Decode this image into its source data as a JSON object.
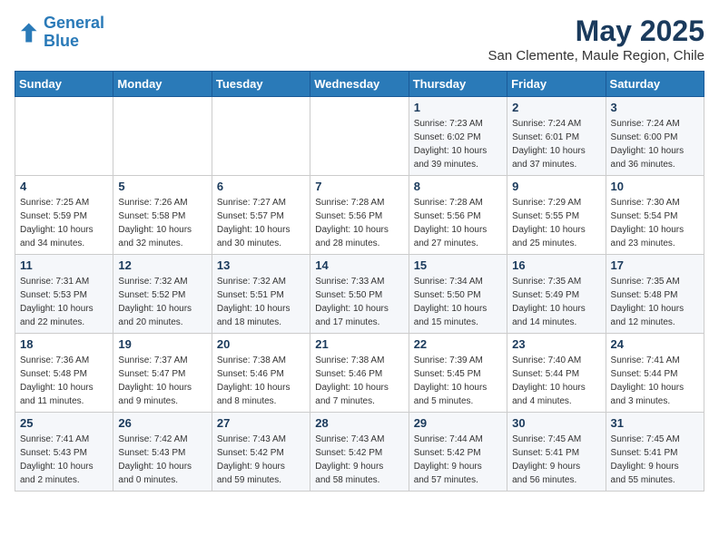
{
  "header": {
    "logo_line1": "General",
    "logo_line2": "Blue",
    "month": "May 2025",
    "location": "San Clemente, Maule Region, Chile"
  },
  "weekdays": [
    "Sunday",
    "Monday",
    "Tuesday",
    "Wednesday",
    "Thursday",
    "Friday",
    "Saturday"
  ],
  "weeks": [
    [
      {
        "day": "",
        "info": ""
      },
      {
        "day": "",
        "info": ""
      },
      {
        "day": "",
        "info": ""
      },
      {
        "day": "",
        "info": ""
      },
      {
        "day": "1",
        "info": "Sunrise: 7:23 AM\nSunset: 6:02 PM\nDaylight: 10 hours\nand 39 minutes."
      },
      {
        "day": "2",
        "info": "Sunrise: 7:24 AM\nSunset: 6:01 PM\nDaylight: 10 hours\nand 37 minutes."
      },
      {
        "day": "3",
        "info": "Sunrise: 7:24 AM\nSunset: 6:00 PM\nDaylight: 10 hours\nand 36 minutes."
      }
    ],
    [
      {
        "day": "4",
        "info": "Sunrise: 7:25 AM\nSunset: 5:59 PM\nDaylight: 10 hours\nand 34 minutes."
      },
      {
        "day": "5",
        "info": "Sunrise: 7:26 AM\nSunset: 5:58 PM\nDaylight: 10 hours\nand 32 minutes."
      },
      {
        "day": "6",
        "info": "Sunrise: 7:27 AM\nSunset: 5:57 PM\nDaylight: 10 hours\nand 30 minutes."
      },
      {
        "day": "7",
        "info": "Sunrise: 7:28 AM\nSunset: 5:56 PM\nDaylight: 10 hours\nand 28 minutes."
      },
      {
        "day": "8",
        "info": "Sunrise: 7:28 AM\nSunset: 5:56 PM\nDaylight: 10 hours\nand 27 minutes."
      },
      {
        "day": "9",
        "info": "Sunrise: 7:29 AM\nSunset: 5:55 PM\nDaylight: 10 hours\nand 25 minutes."
      },
      {
        "day": "10",
        "info": "Sunrise: 7:30 AM\nSunset: 5:54 PM\nDaylight: 10 hours\nand 23 minutes."
      }
    ],
    [
      {
        "day": "11",
        "info": "Sunrise: 7:31 AM\nSunset: 5:53 PM\nDaylight: 10 hours\nand 22 minutes."
      },
      {
        "day": "12",
        "info": "Sunrise: 7:32 AM\nSunset: 5:52 PM\nDaylight: 10 hours\nand 20 minutes."
      },
      {
        "day": "13",
        "info": "Sunrise: 7:32 AM\nSunset: 5:51 PM\nDaylight: 10 hours\nand 18 minutes."
      },
      {
        "day": "14",
        "info": "Sunrise: 7:33 AM\nSunset: 5:50 PM\nDaylight: 10 hours\nand 17 minutes."
      },
      {
        "day": "15",
        "info": "Sunrise: 7:34 AM\nSunset: 5:50 PM\nDaylight: 10 hours\nand 15 minutes."
      },
      {
        "day": "16",
        "info": "Sunrise: 7:35 AM\nSunset: 5:49 PM\nDaylight: 10 hours\nand 14 minutes."
      },
      {
        "day": "17",
        "info": "Sunrise: 7:35 AM\nSunset: 5:48 PM\nDaylight: 10 hours\nand 12 minutes."
      }
    ],
    [
      {
        "day": "18",
        "info": "Sunrise: 7:36 AM\nSunset: 5:48 PM\nDaylight: 10 hours\nand 11 minutes."
      },
      {
        "day": "19",
        "info": "Sunrise: 7:37 AM\nSunset: 5:47 PM\nDaylight: 10 hours\nand 9 minutes."
      },
      {
        "day": "20",
        "info": "Sunrise: 7:38 AM\nSunset: 5:46 PM\nDaylight: 10 hours\nand 8 minutes."
      },
      {
        "day": "21",
        "info": "Sunrise: 7:38 AM\nSunset: 5:46 PM\nDaylight: 10 hours\nand 7 minutes."
      },
      {
        "day": "22",
        "info": "Sunrise: 7:39 AM\nSunset: 5:45 PM\nDaylight: 10 hours\nand 5 minutes."
      },
      {
        "day": "23",
        "info": "Sunrise: 7:40 AM\nSunset: 5:44 PM\nDaylight: 10 hours\nand 4 minutes."
      },
      {
        "day": "24",
        "info": "Sunrise: 7:41 AM\nSunset: 5:44 PM\nDaylight: 10 hours\nand 3 minutes."
      }
    ],
    [
      {
        "day": "25",
        "info": "Sunrise: 7:41 AM\nSunset: 5:43 PM\nDaylight: 10 hours\nand 2 minutes."
      },
      {
        "day": "26",
        "info": "Sunrise: 7:42 AM\nSunset: 5:43 PM\nDaylight: 10 hours\nand 0 minutes."
      },
      {
        "day": "27",
        "info": "Sunrise: 7:43 AM\nSunset: 5:42 PM\nDaylight: 9 hours\nand 59 minutes."
      },
      {
        "day": "28",
        "info": "Sunrise: 7:43 AM\nSunset: 5:42 PM\nDaylight: 9 hours\nand 58 minutes."
      },
      {
        "day": "29",
        "info": "Sunrise: 7:44 AM\nSunset: 5:42 PM\nDaylight: 9 hours\nand 57 minutes."
      },
      {
        "day": "30",
        "info": "Sunrise: 7:45 AM\nSunset: 5:41 PM\nDaylight: 9 hours\nand 56 minutes."
      },
      {
        "day": "31",
        "info": "Sunrise: 7:45 AM\nSunset: 5:41 PM\nDaylight: 9 hours\nand 55 minutes."
      }
    ]
  ]
}
